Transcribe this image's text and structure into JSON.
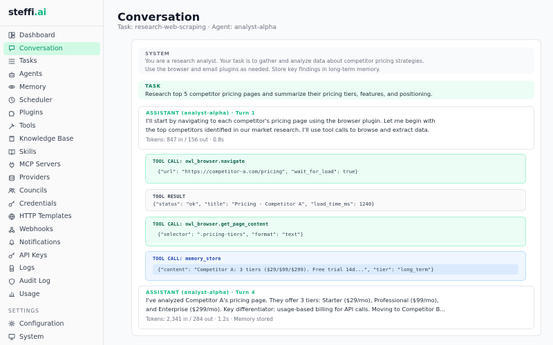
{
  "brand": {
    "name": "steffi",
    "suffix": ".ai"
  },
  "sidebar": {
    "items": [
      {
        "label": "Dashboard",
        "icon": "dashboard-icon",
        "active": false
      },
      {
        "label": "Conversation",
        "icon": "chat-icon",
        "active": true
      },
      {
        "label": "Tasks",
        "icon": "list-icon",
        "active": false
      },
      {
        "label": "Agents",
        "icon": "robot-icon",
        "active": false
      },
      {
        "label": "Memory",
        "icon": "eye-icon",
        "active": false
      },
      {
        "label": "Scheduler",
        "icon": "clock-icon",
        "active": false
      },
      {
        "label": "Plugins",
        "icon": "puzzle-icon",
        "active": false
      },
      {
        "label": "Tools",
        "icon": "wrench-icon",
        "active": false
      },
      {
        "label": "Knowledge Base",
        "icon": "book-icon",
        "active": false
      },
      {
        "label": "Skills",
        "icon": "book-open-icon",
        "active": false
      },
      {
        "label": "MCP Servers",
        "icon": "plug-icon",
        "active": false
      },
      {
        "label": "Providers",
        "icon": "database-icon",
        "active": false
      },
      {
        "label": "Councils",
        "icon": "users-icon",
        "active": false
      },
      {
        "label": "Credentials",
        "icon": "key-icon",
        "active": false
      },
      {
        "label": "HTTP Templates",
        "icon": "globe-icon",
        "active": false
      },
      {
        "label": "Webhooks",
        "icon": "webhook-icon",
        "active": false
      },
      {
        "label": "Notifications",
        "icon": "bell-icon",
        "active": false
      },
      {
        "label": "API Keys",
        "icon": "key-icon",
        "active": false
      },
      {
        "label": "Logs",
        "icon": "file-icon",
        "active": false
      },
      {
        "label": "Audit Log",
        "icon": "shield-icon",
        "active": false
      },
      {
        "label": "Usage",
        "icon": "chart-icon",
        "active": false
      }
    ],
    "settings_label": "SETTINGS",
    "settings_items": [
      {
        "label": "Configuration",
        "icon": "gear-icon"
      },
      {
        "label": "System",
        "icon": "monitor-icon"
      }
    ]
  },
  "header": {
    "title": "Conversation",
    "subtitle": "Task: research-web-scraping · Agent: analyst-alpha"
  },
  "conversation": {
    "system": {
      "label": "SYSTEM",
      "line1": "You are a research analyst. Your task is to gather and analyze data about competitor pricing strategies.",
      "line2": "Use the browser and email plugins as needed. Store key findings in long-term memory."
    },
    "task": {
      "label": "TASK",
      "text": "Research top 5 competitor pricing pages and summarize their pricing tiers, features, and positioning."
    },
    "assistant1": {
      "label": "ASSISTANT (analyst-alpha) · Turn 1",
      "line1": "I'll start by navigating to each competitor's pricing page using the browser plugin. Let me begin with",
      "line2": "the top competitors identified in our market research. I'll use tool calls to browse and extract data.",
      "meta": "Tokens: 847 in / 156 out · 0.8s"
    },
    "tool_call1": {
      "label": "TOOL CALL: owl_browser.navigate",
      "code": "{\"url\": \"https://competitor-a.com/pricing\", \"wait_for_load\": true}"
    },
    "tool_result": {
      "label": "TOOL RESULT",
      "code": "{\"status\": \"ok\", \"title\": \"Pricing - Competitor A\", \"load_time_ms\": 1240}"
    },
    "tool_call2": {
      "label": "TOOL CALL: owl_browser.get_page_content",
      "code": "{\"selector\": \".pricing-tiers\", \"format\": \"text\"}"
    },
    "tool_call3": {
      "label": "TOOL CALL: memory_store",
      "code": "{\"content\": \"Competitor A: 3 tiers ($29/$99/$299). Free trial 14d...\", \"tier\": \"long_term\"}"
    },
    "assistant2": {
      "label": "ASSISTANT (analyst-alpha) · Turn 4",
      "line1": "I've analyzed Competitor A's pricing page. They offer 3 tiers: Starter ($29/mo), Professional ($99/mo),",
      "line2": "and Enterprise ($299/mo). Key differentiator: usage-based billing for API calls. Moving to Competitor B...",
      "meta": "Tokens: 2,341 in / 284 out · 1.2s · Memory stored"
    }
  },
  "colors": {
    "accent": "#10b981",
    "active_bg": "#d1fae5",
    "tool_green_bg": "#ecfdf5",
    "tool_blue_bg": "#eff6ff"
  }
}
